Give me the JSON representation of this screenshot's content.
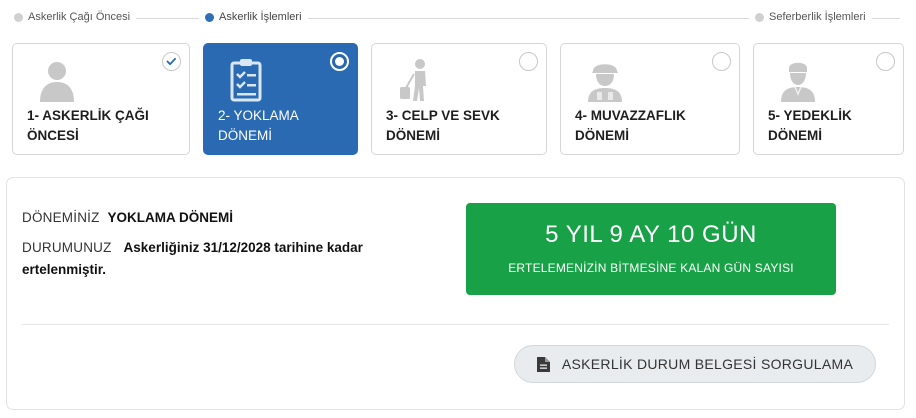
{
  "stepper": {
    "steps": [
      {
        "label": "Askerlik Çağı Öncesi",
        "active": false
      },
      {
        "label": "Askerlik İşlemleri",
        "active": true
      },
      {
        "label": "Seferberlik İşlemleri",
        "active": false
      }
    ]
  },
  "cards": [
    {
      "line1": "1- ASKERLİK ÇAĞI",
      "line2": "ÖNCESİ",
      "icon": "person-icon",
      "state": "checked"
    },
    {
      "line1": "2- YOKLAMA",
      "line2": "DÖNEMİ",
      "icon": "clipboard-checklist-icon",
      "state": "selected"
    },
    {
      "line1": "3- CELP VE SEVK",
      "line2": "DÖNEMİ",
      "icon": "traveler-luggage-icon",
      "state": "unselected"
    },
    {
      "line1": "4- MUVAZZAFLIK",
      "line2": "DÖNEMİ",
      "icon": "soldier-helmet-icon",
      "state": "unselected"
    },
    {
      "line1": "5- YEDEKLİK",
      "line2": "DÖNEMİ",
      "icon": "reservist-icon",
      "state": "unselected"
    }
  ],
  "status": {
    "period_label": "DÖNEMİNİZ",
    "period_value": "YOKLAMA DÖNEMİ",
    "status_label": "DURUMUNUZ",
    "status_value_line1": "Askerliğiniz 31/12/2028 tarihine kadar",
    "status_value_line2": "ertelenmiştir."
  },
  "countdown": {
    "value": "5 YIL 9 AY 10 GÜN",
    "caption": "ERTELEMENİZİN BİTMESİNE KALAN GÜN SAYISI",
    "color": "#18a146"
  },
  "actions": {
    "query_button": "ASKERLİK DURUM BELGESİ SORGULAMA",
    "query_icon": "document-icon"
  },
  "colors": {
    "accent": "#2a6ab3",
    "success": "#18a146"
  }
}
